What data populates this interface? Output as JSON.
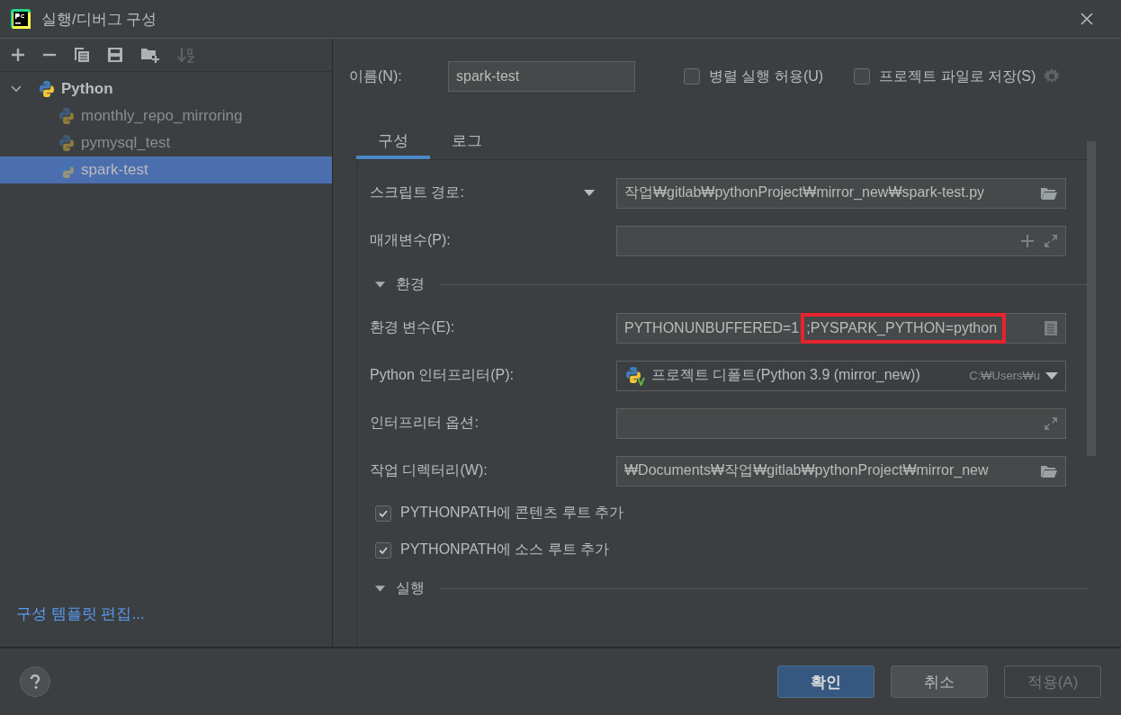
{
  "window": {
    "title": "실행/디버그 구성"
  },
  "toolbar": [
    {
      "kind": "add",
      "disabled": false
    },
    {
      "kind": "remove",
      "disabled": false
    },
    {
      "kind": "copy",
      "disabled": false
    },
    {
      "kind": "save",
      "disabled": false
    },
    {
      "kind": "folder",
      "disabled": false
    },
    {
      "kind": "sort",
      "disabled": true
    }
  ],
  "tree": {
    "label": "Python",
    "expanded": true,
    "children": [
      {
        "label": "monthly_repo_mirroring",
        "selected": false
      },
      {
        "label": "pymysql_test",
        "selected": false
      },
      {
        "label": "spark-test",
        "selected": true
      }
    ]
  },
  "edit_templates_link": "구성 템플릿 편집...",
  "name_field": {
    "label": "이름(N):",
    "value": "spark-test"
  },
  "options": [
    {
      "label": "병렬 실행 허용(U)",
      "checked": false
    },
    {
      "label": "프로젝트 파일로 저장(S)",
      "checked": false
    }
  ],
  "tabs": [
    {
      "label": "구성",
      "selected": true
    },
    {
      "label": "로그",
      "selected": false
    }
  ],
  "form": [
    {
      "kind": "script-path",
      "label": "스크립트 경로:",
      "value": "작업₩gitlab₩pythonProject₩mirror_new₩spark-test.py"
    },
    {
      "kind": "params",
      "label": "매개변수(P):"
    },
    {
      "kind": "section",
      "label": "환경",
      "expanded": true
    },
    {
      "kind": "env",
      "label": "환경 변수(E):",
      "value": "PYTHONUNBUFFERED=1",
      "highlighted_value": ";PYSPARK_PYTHON=python"
    },
    {
      "kind": "interpreter",
      "label": "Python 인터프리터(P):",
      "value": "프로젝트 디폴트(Python 3.9 (mirror_new))",
      "hint": "C:₩Users₩u"
    },
    {
      "kind": "expand",
      "label": "인터프리터 옵션:"
    },
    {
      "kind": "path",
      "label": "작업 디렉터리(W):",
      "value": "₩Documents₩작업₩gitlab₩pythonProject₩mirror_new"
    },
    {
      "kind": "checkbox",
      "label": "PYTHONPATH에 콘텐츠 루트 추가",
      "checked": true
    },
    {
      "kind": "checkbox",
      "label": "PYTHONPATH에 소스 루트 추가",
      "checked": true
    },
    {
      "kind": "section",
      "label": "실행",
      "expanded": true
    }
  ],
  "buttons": [
    {
      "label": "확인",
      "kind": "primary"
    },
    {
      "label": "취소",
      "kind": "normal"
    },
    {
      "label": "적용(A)",
      "kind": "disabled"
    }
  ]
}
